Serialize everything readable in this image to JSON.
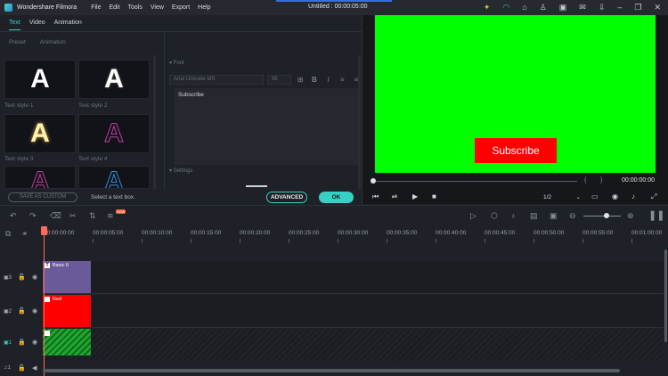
{
  "app": {
    "name": "Wondershare Filmora",
    "document_title": "Untitled : 00:00:05:00",
    "menu": [
      "File",
      "Edit",
      "Tools",
      "View",
      "Export",
      "Help"
    ],
    "title_icons": [
      "bulb-icon",
      "headset-icon",
      "trash-icon",
      "user-icon",
      "save-icon",
      "mail-icon",
      "download-icon",
      "minimize-icon",
      "restore-icon",
      "close-icon"
    ]
  },
  "left_panel": {
    "tabs": [
      "Text",
      "Video",
      "Animation"
    ],
    "active_tab": "Text",
    "subtabs": [
      "Preset",
      "Animation"
    ],
    "text_styles": [
      {
        "label": "Text style 1",
        "glyph": "A",
        "color": "#ffffff"
      },
      {
        "label": "Text style 2",
        "glyph": "A",
        "color": "#ffffff"
      },
      {
        "label": "Text style 3",
        "glyph": "A",
        "color": "#fff3b0"
      },
      {
        "label": "Text style 4",
        "glyph": "A",
        "color": "#c040a0"
      },
      {
        "label": "",
        "glyph": "A",
        "color": "#c040a0"
      },
      {
        "label": "",
        "glyph": "A",
        "color": "#3a8fd6"
      }
    ],
    "font_section": "Font",
    "font_family": "Arial Unicode MS",
    "font_size": "36",
    "text_content": "Subscribe",
    "settings_section": "Settings",
    "save_custom_label": "SAVE AS CUSTOM",
    "hint": "Select a text box.",
    "advanced_label": "ADVANCED",
    "ok_label": "OK"
  },
  "preview": {
    "subscribe_text": "Subscribe",
    "timecode": "00:00:00:00",
    "ratio": "1/2",
    "brackets": [
      "{",
      "}"
    ]
  },
  "timeline": {
    "ruler_labels": [
      "00:00:00:00",
      "00:00:05:00",
      "00:00:10:00",
      "00:00:15:00",
      "00:00:20:00",
      "00:00:25:00",
      "00:00:30:00",
      "00:00:35:00",
      "00:00:40:00",
      "00:00:45:00",
      "00:00:50:00",
      "00:00:55:00",
      "00:01:00:00"
    ],
    "tracks": [
      {
        "num": "3",
        "clip_name": "Basic 6",
        "clip_color": "#6a5a9a"
      },
      {
        "num": "2",
        "clip_name": "Red",
        "clip_color": "#ff0000"
      },
      {
        "num": "1",
        "clip_name": "",
        "clip_color": "#1fa830"
      }
    ],
    "audio_track_num": "1",
    "new_badge": "NEW"
  }
}
